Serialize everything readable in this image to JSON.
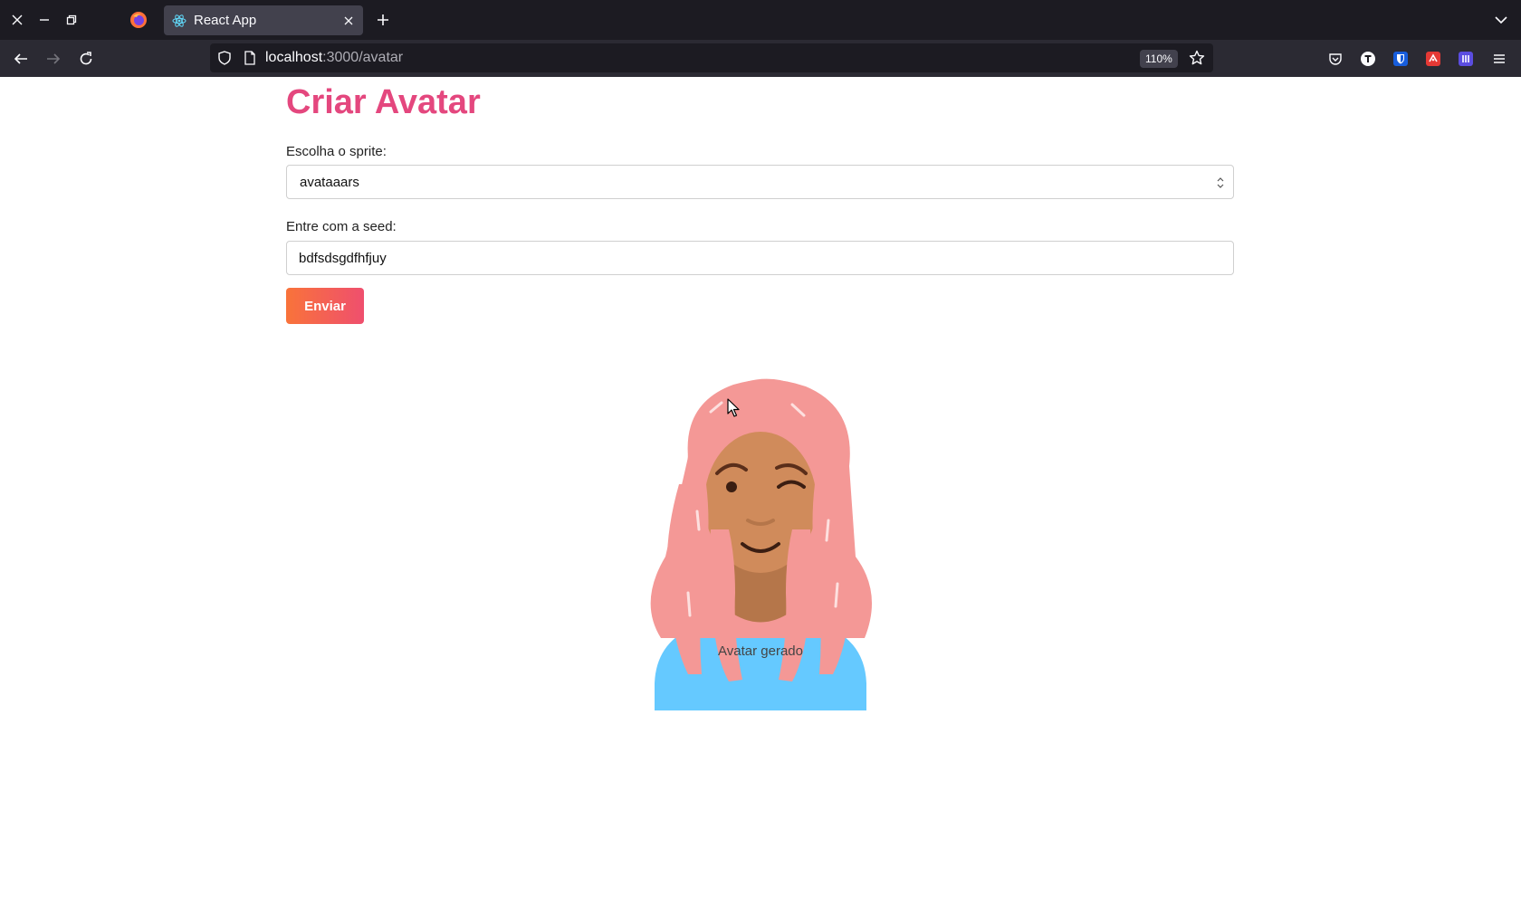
{
  "browser": {
    "tab": {
      "title": "React App"
    },
    "url": {
      "host": "localhost",
      "rest": ":3000/avatar"
    },
    "zoom": "110%"
  },
  "page": {
    "title": "Criar Avatar",
    "sprite_label": "Escolha o sprite:",
    "sprite_value": "avataaars",
    "seed_label": "Entre com a seed:",
    "seed_value": "bdfsdsgdfhfjuy",
    "submit_label": "Enviar",
    "avatar_caption": "Avatar gerado"
  },
  "colors": {
    "title": "#e4477e",
    "button_gradient_start": "#f9733a",
    "button_gradient_end": "#ef4f6e",
    "hair": "#f49896",
    "skin": "#d08b5b",
    "shirt": "#65c9ff"
  }
}
